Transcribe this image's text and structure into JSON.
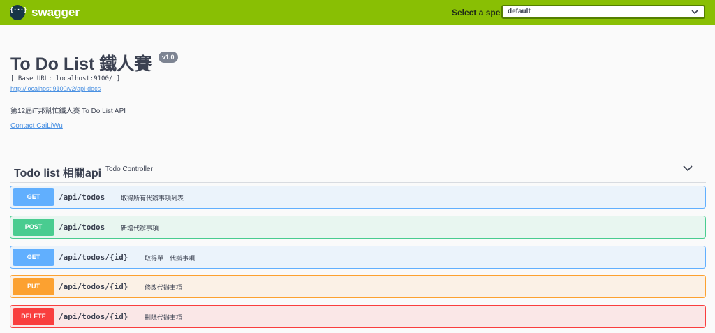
{
  "topbar": {
    "logo_glyph": "{···}",
    "brand": "swagger",
    "spec_label": "Select a spec",
    "spec_selected": "default",
    "colors": {
      "bar": "#89bf04",
      "select_border": "#547f00"
    }
  },
  "info": {
    "title": "To Do List 鐵人賽",
    "version": "v1.0",
    "base_url": "[ Base URL: localhost:9100/ ]",
    "api_docs_link": "http://localhost:9100/v2/api-docs",
    "description": "第12屆iT邦幫忙鐵人賽 To Do List API",
    "contact": "Contact CaiLiWu"
  },
  "tag": {
    "name": "Todo list 相關api",
    "description": "Todo Controller",
    "toggle_icon": "chevron-down-icon"
  },
  "operations": [
    {
      "method": "GET",
      "path": "/api/todos",
      "summary": "取得所有代辦事項列表"
    },
    {
      "method": "POST",
      "path": "/api/todos",
      "summary": "新增代辦事項"
    },
    {
      "method": "GET",
      "path": "/api/todos/{id}",
      "summary": "取得單一代辦事項"
    },
    {
      "method": "PUT",
      "path": "/api/todos/{id}",
      "summary": "修改代辦事項"
    },
    {
      "method": "DELETE",
      "path": "/api/todos/{id}",
      "summary": "刪除代辦事項"
    }
  ],
  "method_colors": {
    "GET": "#61affe",
    "POST": "#49cc90",
    "PUT": "#fca130",
    "DELETE": "#f93e3e"
  }
}
